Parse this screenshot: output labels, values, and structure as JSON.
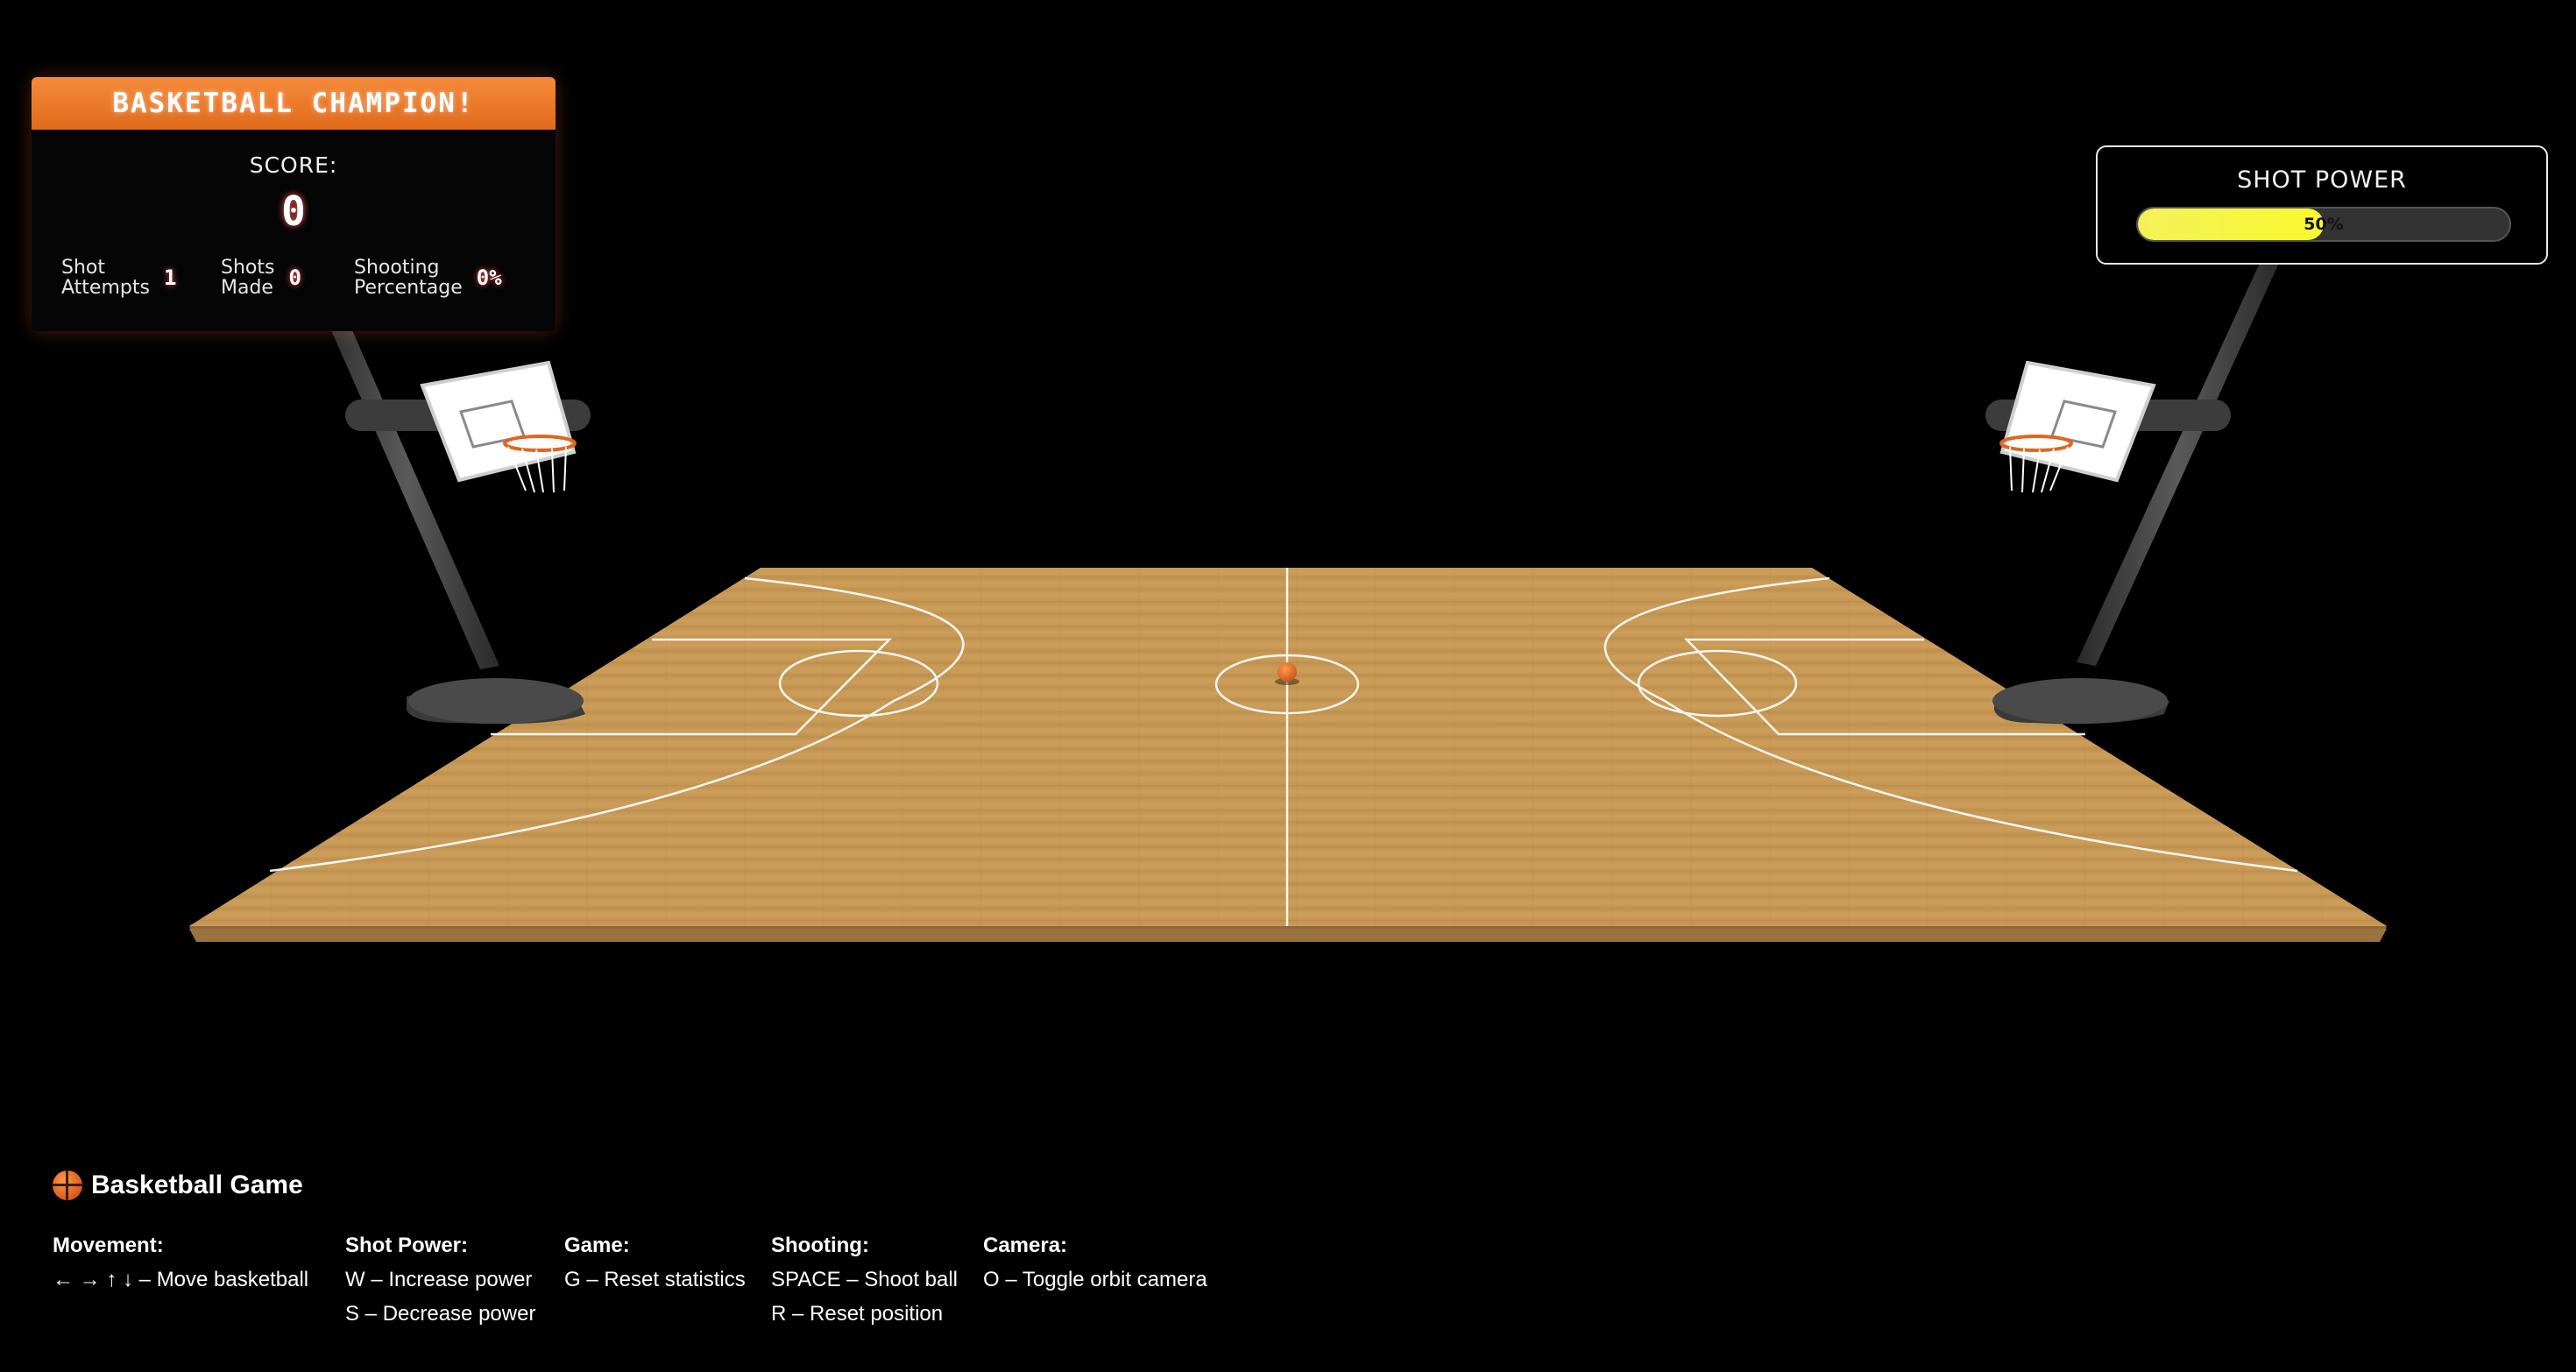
{
  "score_panel": {
    "title": "BASKETBALL CHAMPION!",
    "score_label": "SCORE:",
    "score_value": "0",
    "stats": [
      {
        "label": "Shot\nAttempts",
        "value": "1"
      },
      {
        "label": "Shots\nMade",
        "value": "0"
      },
      {
        "label": "Shooting\nPercentage",
        "value": "0%"
      }
    ]
  },
  "power_panel": {
    "title": "SHOT POWER",
    "value_text": "50%",
    "level": 0.5
  },
  "controls": {
    "title": "Basketball Game",
    "groups": [
      {
        "title": "Movement:",
        "lines": [
          "← → ↑ ↓ – Move basketball"
        ]
      },
      {
        "title": "Shot Power:",
        "lines": [
          "W – Increase power",
          "S – Decrease power"
        ]
      },
      {
        "title": "Game:",
        "lines": [
          "G – Reset statistics"
        ]
      },
      {
        "title": "Shooting:",
        "lines": [
          "SPACE – Shoot ball",
          "R – Reset position"
        ]
      },
      {
        "title": "Camera:",
        "lines": [
          "O – Toggle orbit camera"
        ]
      }
    ]
  },
  "colors": {
    "header_orange": "#e8752a",
    "power_fill": "#f5f33c",
    "court_wood": "#c79a55",
    "ball": "#e0692a"
  }
}
